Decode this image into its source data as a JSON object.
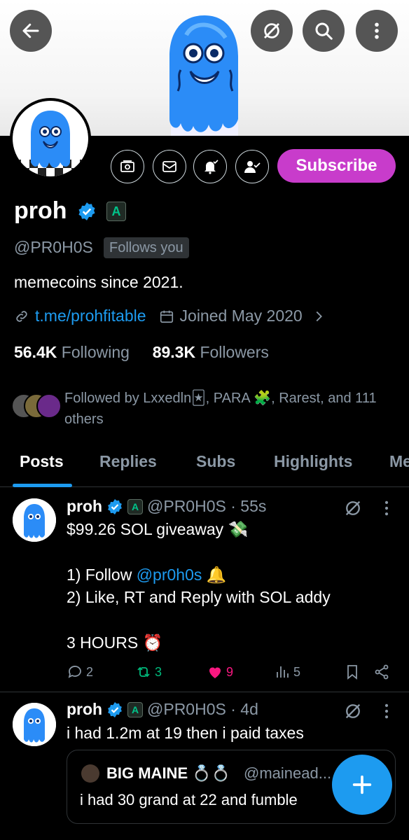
{
  "profile": {
    "name": "proh",
    "badge_letter": "A",
    "handle": "@PR0H0S",
    "follows_you": "Follows you",
    "bio": "memecoins since 2021.",
    "link": "t.me/prohfitable",
    "joined": "Joined May 2020",
    "following_count": "56.4K",
    "following_label": "Following",
    "followers_count": "89.3K",
    "followers_label": "Followers",
    "followed_by": "Followed by Lxxedln🃏, PARA 🧩, Rarest, and 111 others",
    "subscribe_label": "Subscribe"
  },
  "tabs": [
    {
      "label": "Posts"
    },
    {
      "label": "Replies"
    },
    {
      "label": "Subs"
    },
    {
      "label": "Highlights"
    },
    {
      "label": "Me"
    }
  ],
  "posts": [
    {
      "name": "proh",
      "badge_letter": "A",
      "handle_time": "@PR0H0S · 55s",
      "line1": "$99.26 SOL giveaway 💸",
      "line2a": "1) Follow ",
      "line2_mention": "@pr0h0s",
      "line2b": " 🔔",
      "line3": "2) Like, RT and Reply with SOL addy",
      "line4": "3 HOURS ⏰",
      "replies": "2",
      "reposts": "3",
      "likes": "9",
      "views": "5"
    },
    {
      "name": "proh",
      "badge_letter": "A",
      "handle_time": "@PR0H0S · 4d",
      "text": "i had 1.2m at 19 then i paid taxes",
      "quote_name": "BIG MAINE 💍💍",
      "quote_handle": "@mainead...",
      "quote_text": "i had  30 grand at 22 and fumble"
    }
  ],
  "colors": {
    "accent": "#1d9bf0",
    "subscribe": "#c83ccb",
    "like": "#f91880",
    "repost": "#00ba7c"
  },
  "icons": [
    "back-arrow-icon",
    "no-spam-icon",
    "search-icon",
    "more-vertical-icon",
    "tip-jar-icon",
    "mail-icon",
    "bell-icon",
    "person-check-icon",
    "verified-icon",
    "link-icon",
    "calendar-icon",
    "chevron-right-icon",
    "reply-icon",
    "repost-icon",
    "heart-icon",
    "views-icon",
    "bookmark-icon",
    "share-icon",
    "plus-icon"
  ]
}
